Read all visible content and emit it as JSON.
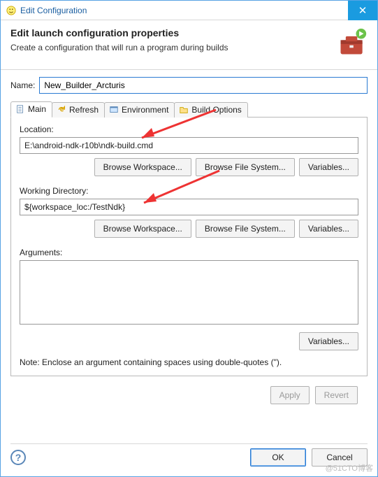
{
  "window": {
    "title": "Edit Configuration",
    "close_glyph": "✕"
  },
  "header": {
    "title": "Edit launch configuration properties",
    "subtitle": "Create a configuration that will run a program during builds"
  },
  "name": {
    "label": "Name:",
    "value": "New_Builder_Arcturis"
  },
  "tabs": {
    "main": "Main",
    "refresh": "Refresh",
    "environment": "Environment",
    "build_options": "Build Options"
  },
  "main_panel": {
    "location_label": "Location:",
    "location_value": "E:\\android-ndk-r10b\\ndk-build.cmd",
    "working_dir_label": "Working Directory:",
    "working_dir_value": "${workspace_loc:/TestNdk}",
    "arguments_label": "Arguments:",
    "arguments_value": "",
    "browse_workspace": "Browse Workspace...",
    "browse_filesystem": "Browse File System...",
    "variables": "Variables...",
    "note": "Note: Enclose an argument containing spaces using double-quotes (\")."
  },
  "actions": {
    "apply": "Apply",
    "revert": "Revert",
    "ok": "OK",
    "cancel": "Cancel"
  },
  "watermark": "@51CTO博客"
}
